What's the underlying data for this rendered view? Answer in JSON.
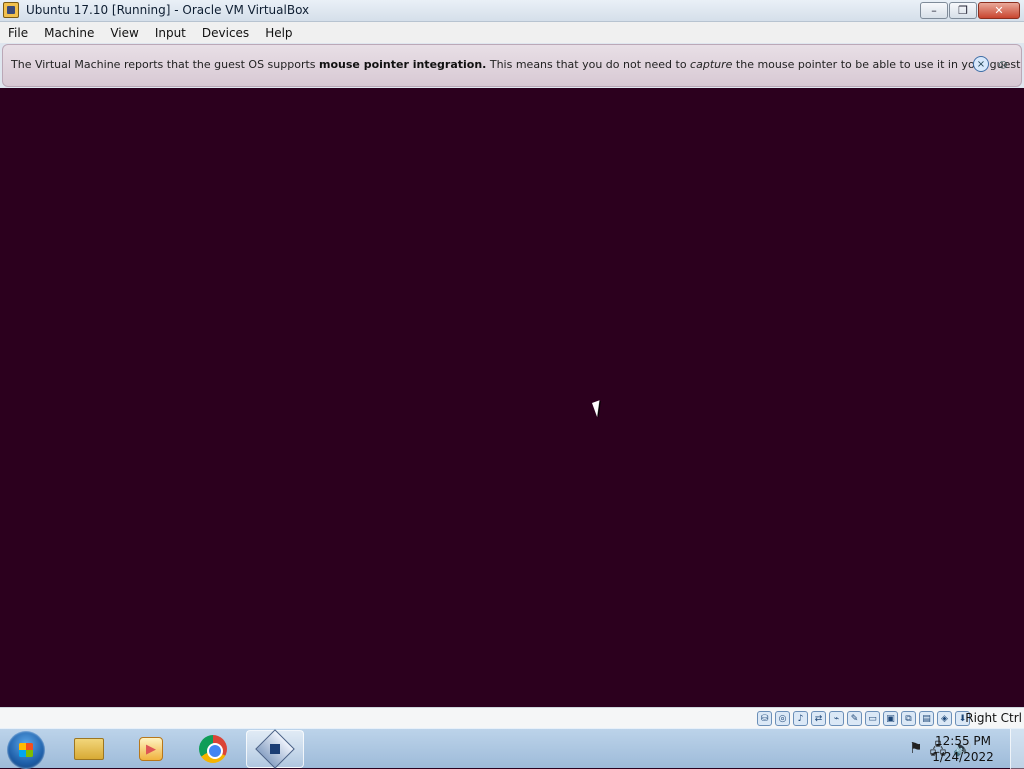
{
  "window": {
    "title": "Ubuntu 17.10 [Running] - Oracle VM VirtualBox",
    "buttons": [
      "minimize",
      "restore",
      "close"
    ]
  },
  "menubar": {
    "items": [
      {
        "label": "File"
      },
      {
        "label": "Machine"
      },
      {
        "label": "View"
      },
      {
        "label": "Input"
      },
      {
        "label": "Devices"
      },
      {
        "label": "Help"
      }
    ]
  },
  "notice": {
    "text_before": "The Virtual Machine reports that the guest OS supports ",
    "bold": "mouse pointer integration.",
    "text_middle": " This means that you do not need to ",
    "italic": "capture",
    "text_after": " the mouse pointer to be able to use it in your guest OS -- all mouse"
  },
  "status_bar": {
    "host_key": "Right Ctrl",
    "icons": [
      "hard-disk-icon",
      "optical-drive-icon",
      "audio-icon",
      "network-icon",
      "usb-icon",
      "pencil-icon",
      "shared-folder-icon",
      "display-icon",
      "video-capture-icon",
      "cpu-icon",
      "mouse-integration-icon",
      "keyboard-icon"
    ]
  },
  "taskbar": {
    "items": [
      "file-explorer-icon",
      "media-player-icon",
      "chrome-icon",
      "virtualbox-icon"
    ],
    "time": "12:55 PM",
    "date": "1/24/2022"
  }
}
